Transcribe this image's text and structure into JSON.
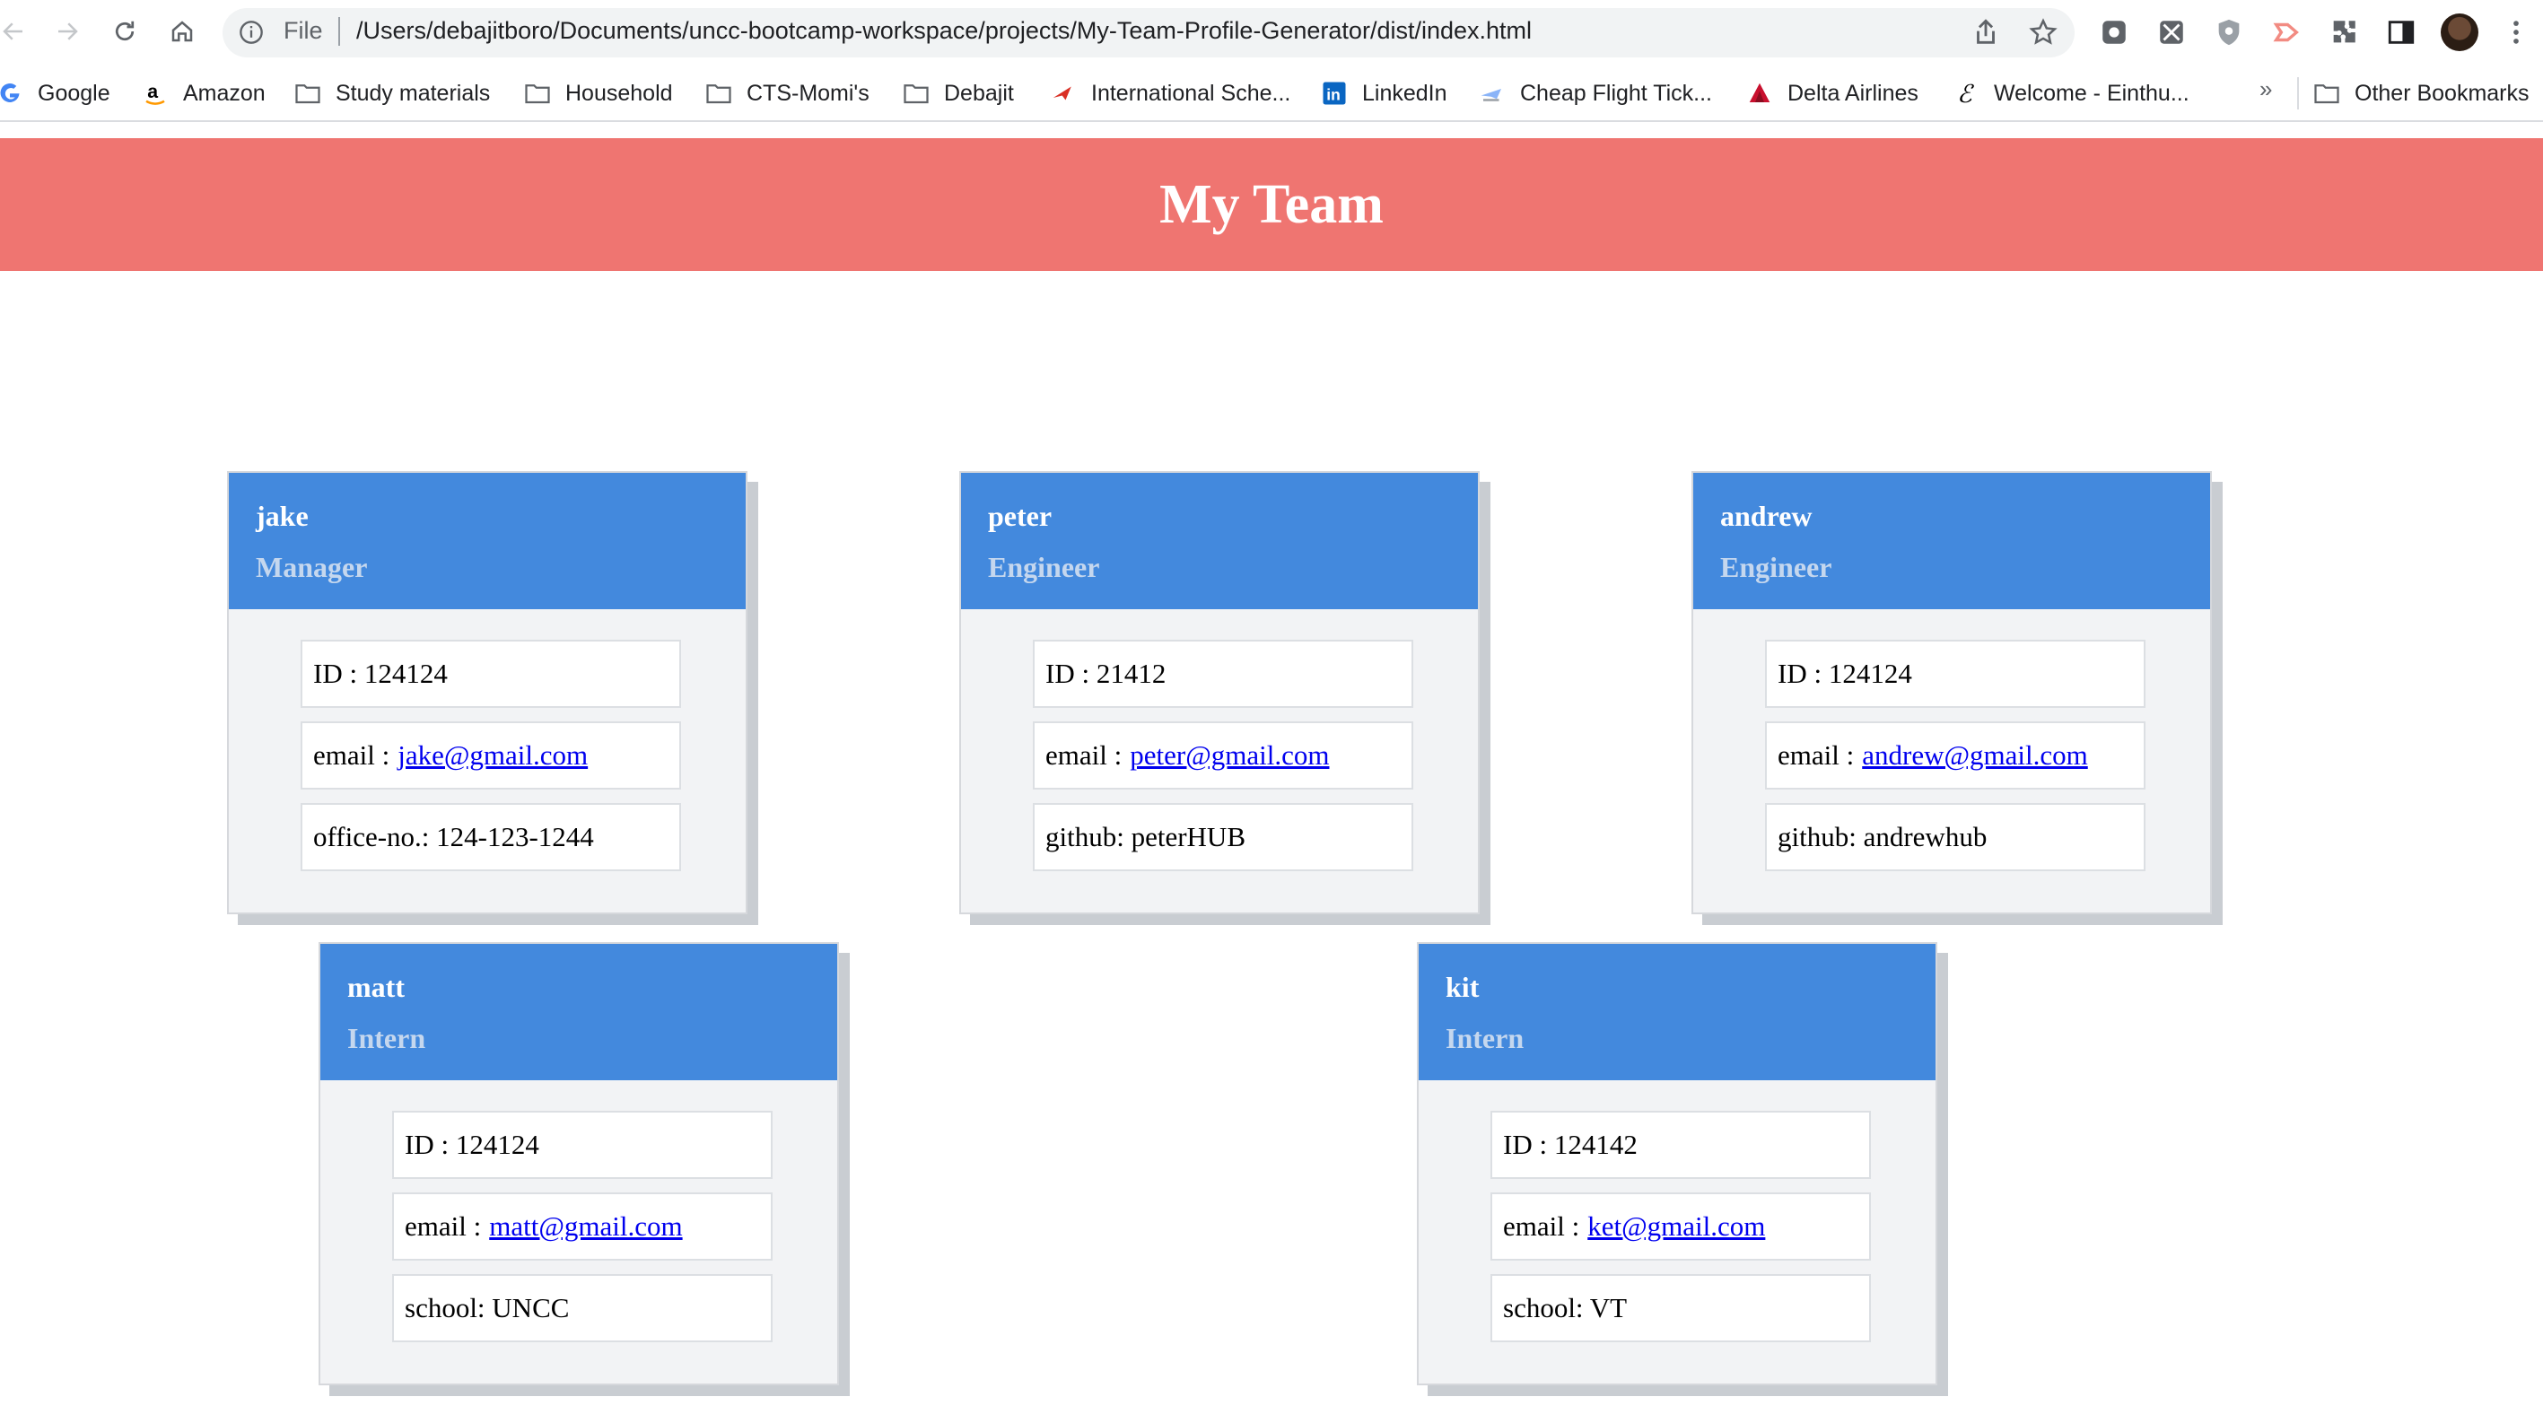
{
  "browser": {
    "omnibox": {
      "scheme_label": "File",
      "url": "/Users/debajitboro/Documents/uncc-bootcamp-workspace/projects/My-Team-Profile-Generator/dist/index.html"
    },
    "bookmarks": [
      {
        "label": "Google",
        "icon": "google-icon"
      },
      {
        "label": "Amazon",
        "icon": "amazon-icon"
      },
      {
        "label": "Study materials",
        "icon": "folder-icon"
      },
      {
        "label": "Household",
        "icon": "folder-icon"
      },
      {
        "label": "CTS-Momi's",
        "icon": "folder-icon"
      },
      {
        "label": "Debajit",
        "icon": "folder-icon"
      },
      {
        "label": "International Sche...",
        "icon": "airplane-icon"
      },
      {
        "label": "LinkedIn",
        "icon": "linkedin-icon"
      },
      {
        "label": "Cheap Flight Tick...",
        "icon": "plane-ticket-icon"
      },
      {
        "label": "Delta Airlines",
        "icon": "delta-icon"
      },
      {
        "label": "Welcome - Einthu...",
        "icon": "einthusan-icon"
      }
    ],
    "overflow_label": "»",
    "other_bookmarks": {
      "label": "Other Bookmarks",
      "icon": "folder-icon"
    }
  },
  "page": {
    "title": "My Team",
    "colors": {
      "header": "#ef7571",
      "card_header": "#4389dd",
      "link": "#0000ee"
    },
    "cards": [
      {
        "name": "jake",
        "role": "Manager",
        "id_label": "ID : 124124",
        "email_prefix": "email :",
        "email": "jake@gmail.com",
        "extra": "office-no.: 124-123-1244"
      },
      {
        "name": "peter",
        "role": "Engineer",
        "id_label": "ID : 21412",
        "email_prefix": "email :",
        "email": "peter@gmail.com",
        "extra": "github: peterHUB"
      },
      {
        "name": "andrew",
        "role": "Engineer",
        "id_label": "ID : 124124",
        "email_prefix": "email :",
        "email": "andrew@gmail.com",
        "extra": "github: andrewhub"
      },
      {
        "name": "matt",
        "role": "Intern",
        "id_label": "ID : 124124",
        "email_prefix": "email :",
        "email": "matt@gmail.com",
        "extra": "school: UNCC"
      },
      {
        "name": "kit",
        "role": "Intern",
        "id_label": "ID : 124142",
        "email_prefix": "email :",
        "email": "ket@gmail.com",
        "extra": "school: VT"
      }
    ]
  }
}
